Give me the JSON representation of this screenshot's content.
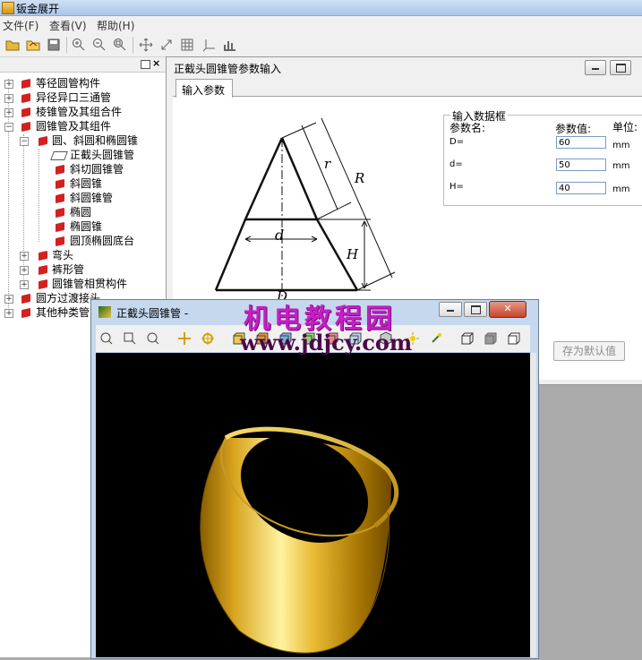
{
  "app": {
    "title": "钣金展开"
  },
  "menu": {
    "file": "文件(F)",
    "view": "查看(V)",
    "help": "帮助(H)"
  },
  "toolbar": {
    "icons": [
      "open-folder-icon",
      "open-file-icon",
      "save-icon",
      "zoom-in-icon",
      "zoom-out-icon",
      "zoom-fit-icon",
      "pan-icon",
      "rotate-icon",
      "grid-icon",
      "axes-icon",
      "bar-chart-icon"
    ]
  },
  "tree": {
    "items": [
      {
        "label": "等径圆管构件"
      },
      {
        "label": "异径异口三通管"
      },
      {
        "label": "棱锥管及其组合件"
      },
      {
        "label": "圆锥管及其组件"
      },
      {
        "label": "圆、斜圆和椭圆锥"
      },
      {
        "label": "正截头圆锥管"
      },
      {
        "label": "斜切圆锥管"
      },
      {
        "label": "斜圆锥"
      },
      {
        "label": "斜圆锥管"
      },
      {
        "label": "椭圆"
      },
      {
        "label": "椭圆锥"
      },
      {
        "label": "圆顶椭圆底台"
      },
      {
        "label": "弯头"
      },
      {
        "label": "裤形管"
      },
      {
        "label": "圆锥管相贯构件"
      },
      {
        "label": "圆方过渡接头"
      },
      {
        "label": "其他种类管"
      }
    ]
  },
  "param_window": {
    "title": "正截头圆锥管参数输入",
    "tab": "输入参数",
    "groupbox_title": "输入数据框",
    "col_name": "参数名:",
    "col_value": "参数值:",
    "col_unit": "单位:",
    "params": [
      {
        "name": "D=",
        "value": "60",
        "unit": "mm"
      },
      {
        "name": "d=",
        "value": "50",
        "unit": "mm"
      },
      {
        "name": "H=",
        "value": "40",
        "unit": "mm"
      }
    ],
    "save_default": "存为默认值"
  },
  "diagram": {
    "labels": {
      "r": "r",
      "R": "R",
      "d": "d",
      "H": "H",
      "D": "D"
    }
  },
  "viewer": {
    "title": "正截头圆锥管 -",
    "cone_color": "#d9a520"
  },
  "watermark": {
    "line1": "机电教程园",
    "line2": "www.jdjcy.com"
  }
}
